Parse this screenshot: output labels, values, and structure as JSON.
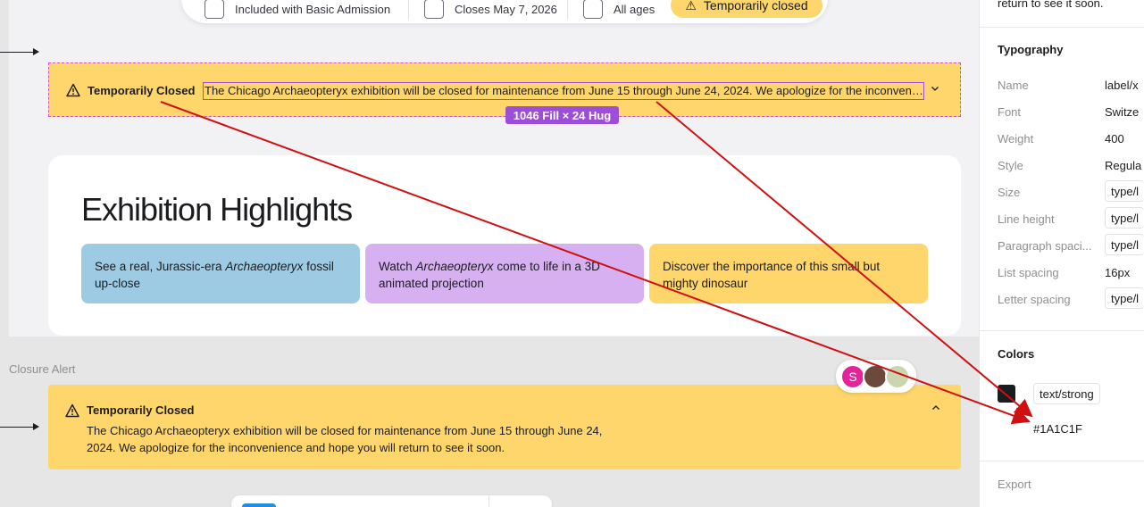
{
  "info_pill": {
    "admission": "Included with Basic Admission",
    "closes": "Closes May 7, 2026",
    "ages": "All ages",
    "badge": "Temporarily closed"
  },
  "alert_selected": {
    "title": "Temporarily Closed",
    "message": "The Chicago Archaeopteryx exhibition will be closed for maintenance from June 15 through June 24, 2024. We apologize for the inconvenience and hope you will return to see it soon.",
    "size_tag": "1046 Fill × 24 Hug"
  },
  "highlights": {
    "heading": "Exhibition Highlights",
    "cards": [
      {
        "pre": "See a real, Jurassic-era ",
        "em": "Archaeopteryx",
        "post": " fossil up-close",
        "color": "#9dcbe3"
      },
      {
        "pre": "Watch ",
        "em": "Archaeopteryx",
        "post": " come to life in a 3D animated projection",
        "color": "#d6b0f0"
      },
      {
        "pre": "Discover the importance of this small but mighty dinosaur",
        "em": "",
        "post": "",
        "color": "#ffd66b"
      }
    ]
  },
  "section_label": "Closure Alert",
  "alert_expanded": {
    "title": "Temporarily Closed",
    "message": "The Chicago Archaeopteryx exhibition will be closed for maintenance from June 15 through June 24, 2024. We apologize for the inconvenience and hope you will return to see it soon."
  },
  "avatars": {
    "first_initial": "S"
  },
  "inspector": {
    "top_text": "return to see it soon.",
    "typography_heading": "Typography",
    "rows": [
      {
        "key": "Name",
        "value": "label/x"
      },
      {
        "key": "Font",
        "value": "Switze"
      },
      {
        "key": "Weight",
        "value": "400"
      },
      {
        "key": "Style",
        "value": "Regula"
      },
      {
        "key": "Size",
        "value": "type/l"
      },
      {
        "key": "Line height",
        "value": "type/l"
      },
      {
        "key": "Paragraph spaci...",
        "value": "type/l"
      },
      {
        "key": "List spacing",
        "value": "16px"
      },
      {
        "key": "Letter spacing",
        "value": "type/l"
      }
    ],
    "colors_heading": "Colors",
    "color_token": "text/strong",
    "color_hex": "#1A1C1F",
    "export_heading": "Export"
  },
  "colors": {
    "alert_yellow": "#ffd66b",
    "selection_purple": "#9c4fd6",
    "annotation_red": "#d01010",
    "text_strong": "#1a1c1f"
  }
}
